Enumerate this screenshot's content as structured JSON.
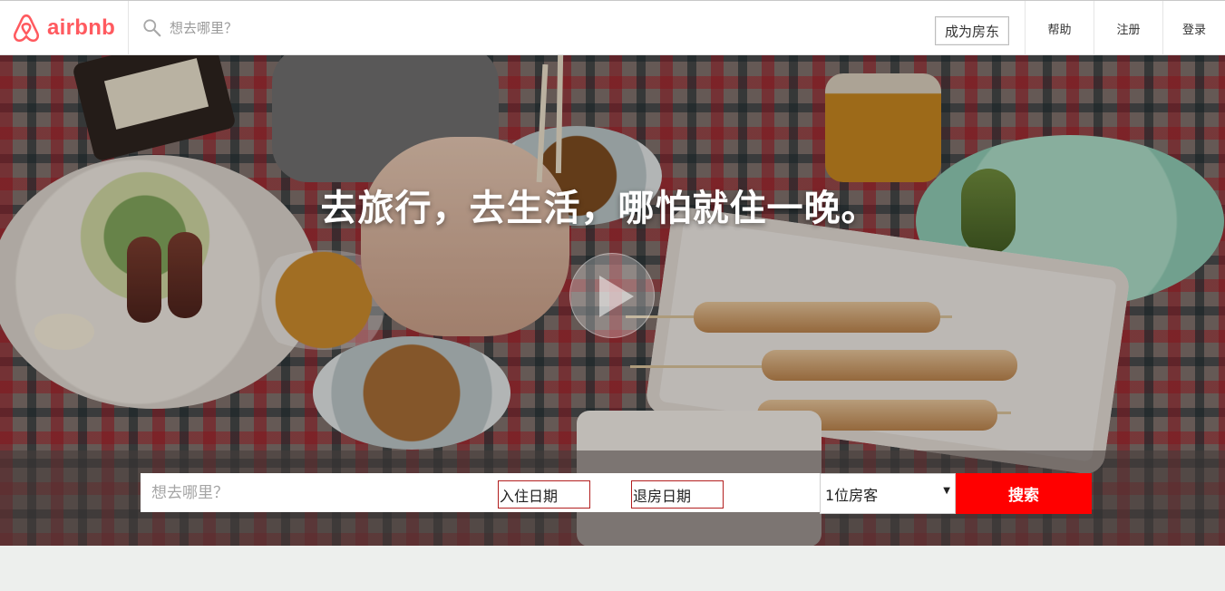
{
  "header": {
    "logo_text": "airbnb",
    "search_placeholder": "想去哪里？",
    "host_button": "成为房东",
    "nav": [
      {
        "label": "帮助"
      },
      {
        "label": "注册"
      },
      {
        "label": "登录"
      }
    ]
  },
  "hero": {
    "title": "去旅行，去生活，哪怕就住一晚。",
    "play_icon": "play-icon"
  },
  "search": {
    "where_placeholder": "想去哪里？",
    "checkin_label": "入住日期",
    "checkout_label": "退房日期",
    "guests_value": "1位房客",
    "submit_label": "搜索"
  },
  "colors": {
    "brand": "#ff5a5f",
    "search_button": "#ff0000",
    "date_border": "#b21e1e"
  }
}
